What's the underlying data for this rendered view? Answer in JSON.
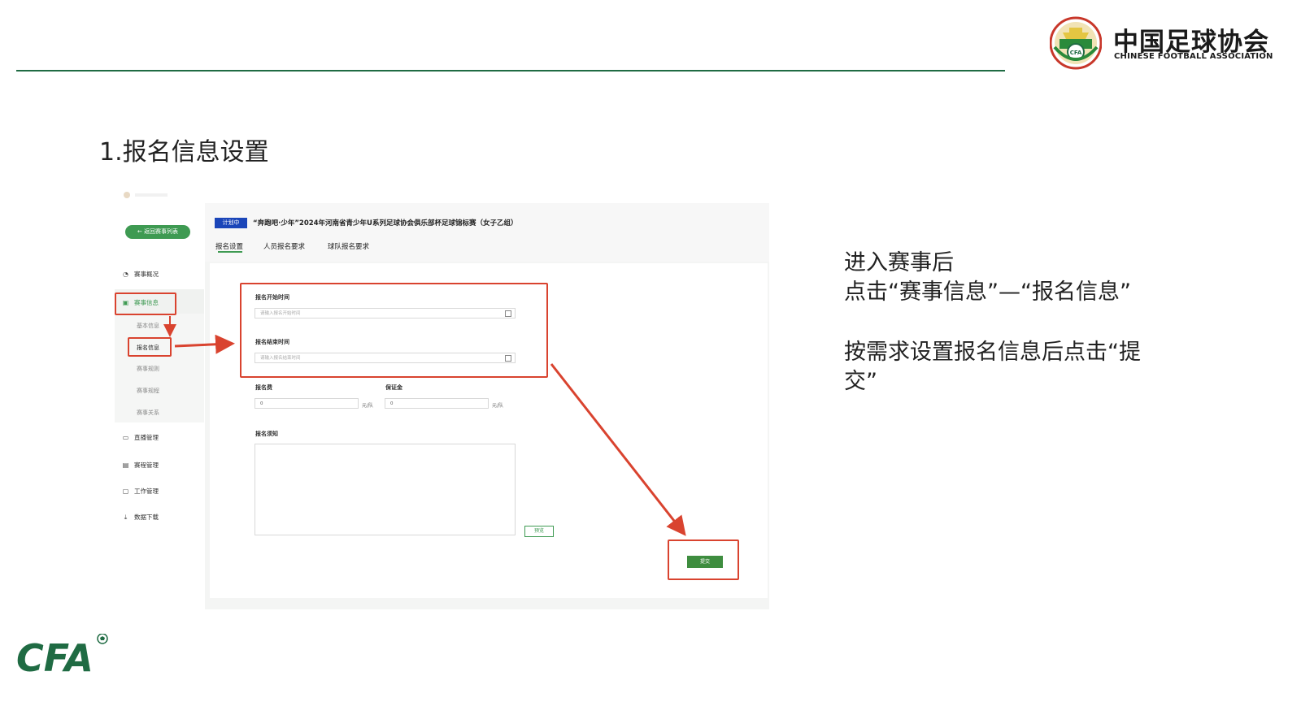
{
  "header": {
    "logo_cn": "中国足球协会",
    "logo_en": "CHINESE FOOTBALL ASSOCIATION",
    "emblem_text": "CFA",
    "emblem_arc_text": "中国足球协会",
    "emblem_icon": "cfa-emblem-icon",
    "colors": {
      "rule": "#1f6b43",
      "brand_green": "#1f7a3e",
      "brand_red": "#d9432f"
    }
  },
  "section_title": "1.报名信息设置",
  "screenshot": {
    "sidebar": {
      "back_button": "← 返回赛事列表",
      "items": [
        {
          "icon": "overview-icon",
          "label": "赛事概况"
        },
        {
          "icon": "info-icon",
          "label": "赛事信息"
        },
        {
          "icon": "live-icon",
          "label": "直播管理"
        },
        {
          "icon": "schedule-icon",
          "label": "赛程管理"
        },
        {
          "icon": "work-icon",
          "label": "工作管理"
        },
        {
          "icon": "download-icon",
          "label": "数据下载"
        }
      ],
      "sub_items": [
        "基本信息",
        "报名信息",
        "赛事规则",
        "赛事规程",
        "赛事关系"
      ]
    },
    "match": {
      "status_badge": "计划中",
      "title": "“奔跑吧·少年”2024年河南省青少年U系列足球协会俱乐部杯足球锦标赛（女子乙组）"
    },
    "tabs": [
      "报名设置",
      "人员报名要求",
      "球队报名要求"
    ],
    "form": {
      "start_label": "报名开始时间",
      "start_placeholder": "请输入报名开始时间",
      "end_label": "报名结束时间",
      "end_placeholder": "请输入报名结束时间",
      "fee_label": "报名费",
      "fee_value": "0",
      "fee_unit": "元/队",
      "deposit_label": "保证金",
      "deposit_value": "0",
      "deposit_unit": "元/队",
      "notice_label": "报名须知",
      "preview_button": "预览",
      "submit_button": "提交"
    }
  },
  "instructions": {
    "line1": "进入赛事后",
    "line2": "点击“赛事信息”—“报名信息”",
    "line3": "按需求设置报名信息后点击“提",
    "line4": "交”"
  },
  "footer": {
    "logo": "CFA"
  }
}
